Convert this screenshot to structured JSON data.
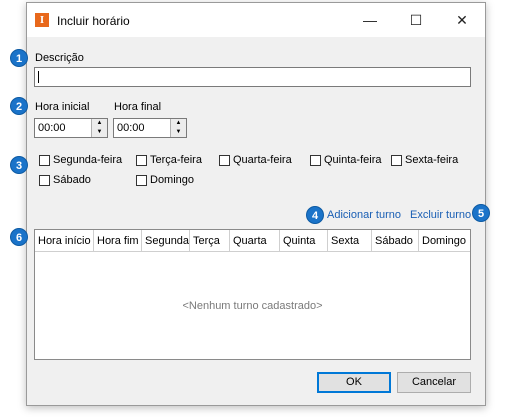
{
  "window": {
    "title": "Incluir horário",
    "app_icon_letter": "I",
    "minimize_glyph": "—",
    "maximize_glyph": "☐",
    "close_glyph": "✕"
  },
  "form": {
    "descricao_label": "Descrição",
    "descricao_value": "",
    "hora_inicial_label": "Hora inicial",
    "hora_inicial_value": "00:00",
    "hora_final_label": "Hora final",
    "hora_final_value": "00:00"
  },
  "days": [
    {
      "label": "Segunda-feira",
      "checked": false
    },
    {
      "label": "Terça-feira",
      "checked": false
    },
    {
      "label": "Quarta-feira",
      "checked": false
    },
    {
      "label": "Quinta-feira",
      "checked": false
    },
    {
      "label": "Sexta-feira",
      "checked": false
    },
    {
      "label": "Sábado",
      "checked": false
    },
    {
      "label": "Domingo",
      "checked": false
    }
  ],
  "actions": {
    "add_turn": "Adicionar turno",
    "remove_turn": "Excluir turno"
  },
  "grid": {
    "columns": [
      "Hora início",
      "Hora fim",
      "Segunda",
      "Terça",
      "Quarta",
      "Quinta",
      "Sexta",
      "Sábado",
      "Domingo"
    ],
    "empty_message": "<Nenhum turno cadastrado>"
  },
  "buttons": {
    "ok": "OK",
    "cancel": "Cancelar"
  },
  "badges": [
    "1",
    "2",
    "3",
    "4",
    "5",
    "6"
  ],
  "colors": {
    "badge": "#1a73c9",
    "link": "#1a5fb4",
    "app_icon": "#e8681b"
  }
}
